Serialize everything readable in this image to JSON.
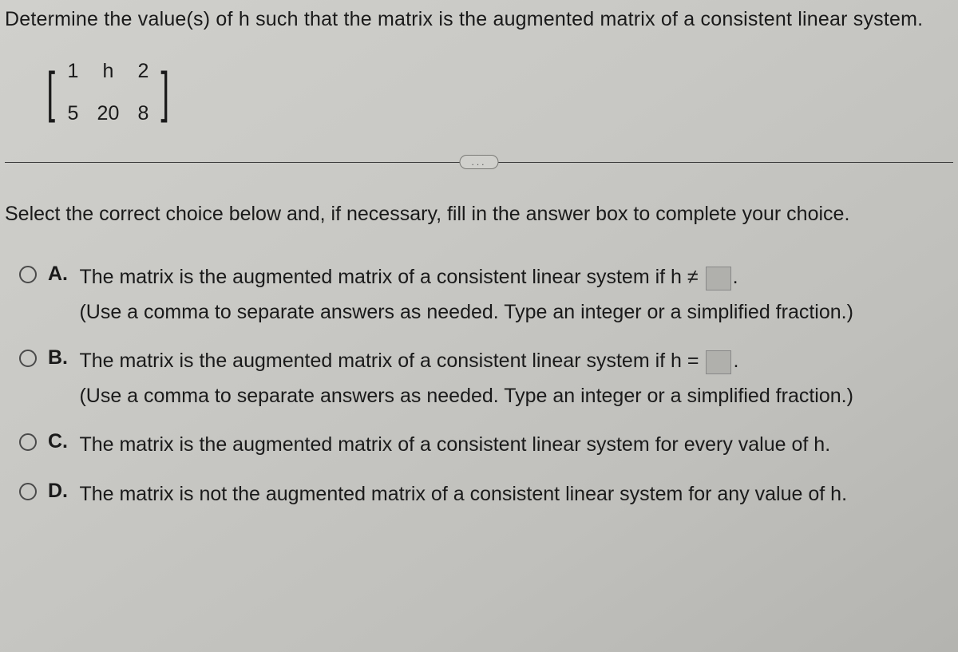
{
  "question": "Determine the value(s) of h such that the matrix is the augmented matrix of a consistent linear system.",
  "matrix": {
    "r1c1": "1",
    "r1c2": "h",
    "r1c3": "2",
    "r2c1": "5",
    "r2c2": "20",
    "r2c3": "8"
  },
  "divider_label": "...",
  "instruction": "Select the correct choice below and, if necessary, fill in the answer box to complete your choice.",
  "options": {
    "A": {
      "label": "A.",
      "text_before": "The matrix is the augmented matrix of a consistent linear system if h ≠",
      "text_after": ".",
      "hint": "(Use a comma to separate answers as needed. Type an integer or a simplified fraction.)"
    },
    "B": {
      "label": "B.",
      "text_before": "The matrix is the augmented matrix of a consistent linear system if h =",
      "text_after": ".",
      "hint": "(Use a comma to separate answers as needed. Type an integer or a simplified fraction.)"
    },
    "C": {
      "label": "C.",
      "text": "The matrix is the augmented matrix of a consistent linear system for every value of h."
    },
    "D": {
      "label": "D.",
      "text": "The matrix is not the augmented matrix of a consistent linear system for any value of h."
    }
  }
}
